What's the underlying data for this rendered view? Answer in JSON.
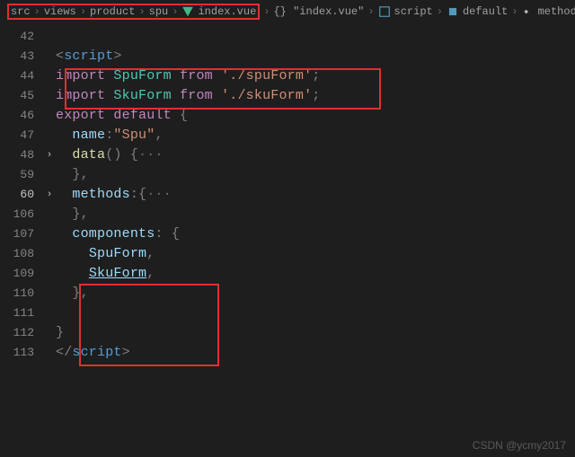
{
  "breadcrumb": {
    "p0": "src",
    "p1": "views",
    "p2": "product",
    "p3": "spu",
    "p4": "index.vue",
    "p5": "{} \"index.vue\"",
    "p6": "script",
    "p7": "default",
    "p8": "methods"
  },
  "lines": {
    "l42": "42",
    "l43": "43",
    "l44": "44",
    "l45": "45",
    "l46": "46",
    "l47": "47",
    "l48": "48",
    "l59": "59",
    "l60": "60",
    "l106": "106",
    "l107": "107",
    "l108": "108",
    "l109": "109",
    "l110": "110",
    "l111": "111",
    "l112": "112",
    "l113": "113"
  },
  "tokens": {
    "lt": "<",
    "gt": ">",
    "script": "script",
    "slashScript": "/",
    "import": "import",
    "SpuForm": "SpuForm",
    "SkuForm": "SkuForm",
    "from": "from",
    "spuPath": "'./spuForm'",
    "skuPath": "'./skuForm'",
    "semi": ";",
    "export": "export",
    "default": "default",
    "lbrace": "{",
    "rbrace": "}",
    "name": "name",
    "colon": ":",
    "spuStr": "\"Spu\"",
    "comma": ",",
    "data": "data",
    "paren": "()",
    "ellipsis": "···",
    "methods": "methods",
    "components": "components"
  },
  "watermark": "CSDN @ycmy2017"
}
